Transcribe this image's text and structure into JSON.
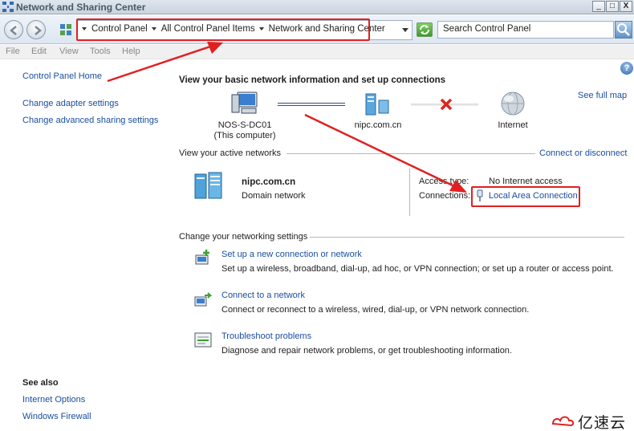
{
  "window": {
    "title": "Network and Sharing Center",
    "controls": [
      "_",
      "□",
      "X"
    ]
  },
  "address_bar": {
    "crumbs": [
      "Control Panel",
      "All Control Panel Items",
      "Network and Sharing Center"
    ],
    "search_placeholder": "Search Control Panel"
  },
  "menu": [
    "File",
    "Edit",
    "View",
    "Tools",
    "Help"
  ],
  "left_pane": {
    "home": "Control Panel Home",
    "links": [
      "Change adapter settings",
      "Change advanced sharing settings"
    ],
    "see_also_title": "See also",
    "see_also": [
      "Internet Options",
      "Windows Firewall"
    ]
  },
  "main": {
    "help_glyph": "?",
    "heading": "View your basic network information and set up connections",
    "see_full_map": "See full map",
    "map": {
      "computer_name": "NOS-S-DC01",
      "computer_sub": "(This computer)",
      "network": "nipc.com.cn",
      "internet": "Internet"
    },
    "active_networks": {
      "title": "View your active networks",
      "connect_link": "Connect or disconnect",
      "name": "nipc.com.cn",
      "type": "Domain network",
      "access_type_label": "Access type:",
      "access_type_value": "No Internet access",
      "connections_label": "Connections:",
      "connection_link": "Local Area Connection"
    },
    "change_settings": {
      "title": "Change your networking settings",
      "tasks": [
        {
          "title": "Set up a new connection or network",
          "desc": "Set up a wireless, broadband, dial-up, ad hoc, or VPN connection; or set up a router or access point."
        },
        {
          "title": "Connect to a network",
          "desc": "Connect or reconnect to a wireless, wired, dial-up, or VPN network connection."
        },
        {
          "title": "Troubleshoot problems",
          "desc": "Diagnose and repair network problems, or get troubleshooting information."
        }
      ]
    }
  },
  "watermark": {
    "text": "亿速云"
  },
  "colors": {
    "link": "#1a4d9e",
    "annotation_red": "#e02020"
  }
}
